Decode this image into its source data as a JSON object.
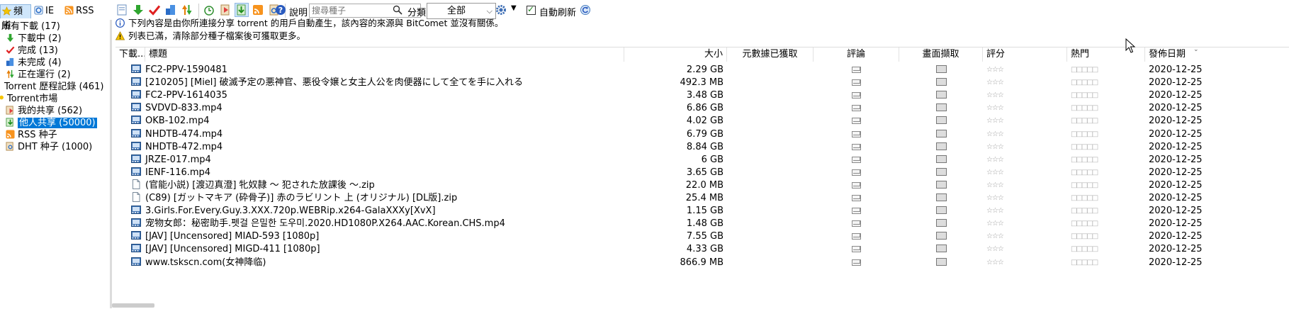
{
  "left_tabs": [
    {
      "label": "頻道",
      "icon": "star-icon"
    },
    {
      "label": "IE",
      "icon": "ie-icon"
    },
    {
      "label": "RSS",
      "icon": "rss-icon"
    }
  ],
  "tree": [
    {
      "label": "所有下載 (17)",
      "indent": 0,
      "icon": "none"
    },
    {
      "label": "下載中 (2)",
      "indent": 1,
      "icon": "arrow-down-icon"
    },
    {
      "label": "完成 (13)",
      "indent": 1,
      "icon": "checkmark-icon"
    },
    {
      "label": "未完成 (4)",
      "indent": 1,
      "icon": "partial-icon"
    },
    {
      "label": "正在運行 (2)",
      "indent": 1,
      "icon": "running-icon"
    },
    {
      "label": "Torrent 歷程記錄 (461)",
      "indent": 0,
      "icon": "none"
    },
    {
      "label": "Torrent市場",
      "indent": 0,
      "icon": "bulb-icon"
    },
    {
      "label": "我的共享 (562)",
      "indent": 1,
      "icon": "share-icon"
    },
    {
      "label": "他人共享 (50000)",
      "indent": 1,
      "icon": "others-share-icon",
      "selected": true
    },
    {
      "label": "RSS 种子",
      "indent": 1,
      "icon": "rss-icon"
    },
    {
      "label": "DHT 种子 (1000)",
      "indent": 1,
      "icon": "dht-icon"
    }
  ],
  "toolbar": {
    "help_label": "說明",
    "search_placeholder": "搜尋種子",
    "category_label": "分類",
    "category_value": "全部",
    "auto_refresh_label": "自動刷新",
    "auto_refresh_checked": true
  },
  "notices": [
    "下列內容是由你所連接分享 torrent 的用戶自動產生，該內容的來源與 BitComet 並沒有關係。",
    "列表已滿，清除部分種子檔案後可獲取更多。"
  ],
  "columns": [
    "下載...",
    "標題",
    "大小",
    "元數據已獲取",
    "評論",
    "畫面擷取",
    "評分",
    "熱門",
    "發佈日期"
  ],
  "rows": [
    {
      "title": "FC2-PPV-1590481",
      "size": "2.29 GB",
      "date": "2020-12-25",
      "type": "video"
    },
    {
      "title": "[210205] [Miel] 破滅予定の悪神官、悪役令嬢と女主人公を肉便器にして全てを手に入れる",
      "size": "492.3 MB",
      "date": "2020-12-25",
      "type": "video"
    },
    {
      "title": "FC2-PPV-1614035",
      "size": "3.48 GB",
      "date": "2020-12-25",
      "type": "video"
    },
    {
      "title": "SVDVD-833.mp4",
      "size": "6.86 GB",
      "date": "2020-12-25",
      "type": "video"
    },
    {
      "title": "OKB-102.mp4",
      "size": "4.02 GB",
      "date": "2020-12-25",
      "type": "video"
    },
    {
      "title": "NHDTB-474.mp4",
      "size": "6.79 GB",
      "date": "2020-12-25",
      "type": "video"
    },
    {
      "title": "NHDTB-472.mp4",
      "size": "8.84 GB",
      "date": "2020-12-25",
      "type": "video"
    },
    {
      "title": "JRZE-017.mp4",
      "size": "6 GB",
      "date": "2020-12-25",
      "type": "video"
    },
    {
      "title": "IENF-116.mp4",
      "size": "3.65 GB",
      "date": "2020-12-25",
      "type": "video"
    },
    {
      "title": "(官能小説) [渡辺真澄] 牝奴隷 ～ 犯された放課後 ～.zip",
      "size": "22.0 MB",
      "date": "2020-12-25",
      "type": "file"
    },
    {
      "title": "(C89) [ガットマキア (砕骨子)] 赤のラビリント 上 (オリジナル) [DL版].zip",
      "size": "25.4 MB",
      "date": "2020-12-25",
      "type": "file"
    },
    {
      "title": "3.Girls.For.Every.Guy.3.XXX.720p.WEBRip.x264-GalaXXXy[XvX]",
      "size": "1.15 GB",
      "date": "2020-12-25",
      "type": "video"
    },
    {
      "title": "宠物女郎：秘密助手.펫걸 은밀한 도우미.2020.HD1080P.X264.AAC.Korean.CHS.mp4",
      "size": "1.48 GB",
      "date": "2020-12-25",
      "type": "video"
    },
    {
      "title": "[JAV] [Uncensored] MIAD-593 [1080p]",
      "size": "7.55 GB",
      "date": "2020-12-25",
      "type": "video"
    },
    {
      "title": "[JAV] [Uncensored] MIGD-411 [1080p]",
      "size": "4.33 GB",
      "date": "2020-12-25",
      "type": "video"
    },
    {
      "title": "www.tskscn.com(女神降临)",
      "size": "866.9 MB",
      "date": "2020-12-25",
      "type": "video"
    }
  ],
  "rating_glyph": "☆☆☆",
  "popularity_glyph": "□□□□□"
}
